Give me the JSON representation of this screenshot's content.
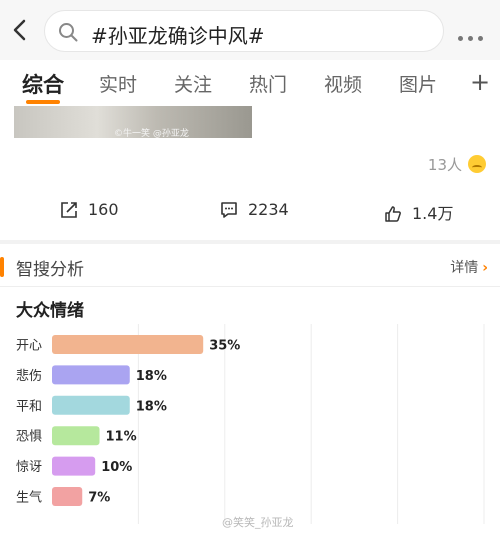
{
  "search": {
    "query": "#孙亚龙确诊中风#"
  },
  "tabs": [
    {
      "label": "综合",
      "active": true
    },
    {
      "label": "实时"
    },
    {
      "label": "关注"
    },
    {
      "label": "热门"
    },
    {
      "label": "视频"
    },
    {
      "label": "图片"
    }
  ],
  "post": {
    "image_watermark": "©牛一笑  @孙亚龙",
    "like_people": "13人",
    "share_count": "160",
    "comment_count": "2234",
    "like_count": "1.4万"
  },
  "analysis": {
    "section_title": "智搜分析",
    "detail_label": "详情",
    "chart_title": "大众情绪",
    "accent_color": "#ff8200"
  },
  "chart_data": {
    "type": "bar",
    "orientation": "horizontal",
    "title": "大众情绪",
    "categories": [
      "开心",
      "悲伤",
      "平和",
      "恐惧",
      "惊讶",
      "生气"
    ],
    "values": [
      35,
      18,
      18,
      11,
      10,
      7
    ],
    "value_labels": [
      "35%",
      "18%",
      "18%",
      "11%",
      "10%",
      "7%"
    ],
    "colors": [
      "#f2b48f",
      "#aaa4f1",
      "#a3d8de",
      "#b6e89d",
      "#d69cef",
      "#f2a2a2"
    ],
    "xlim": [
      0,
      100
    ],
    "grid": true
  },
  "watermark": "@笑笑_孙亚龙"
}
